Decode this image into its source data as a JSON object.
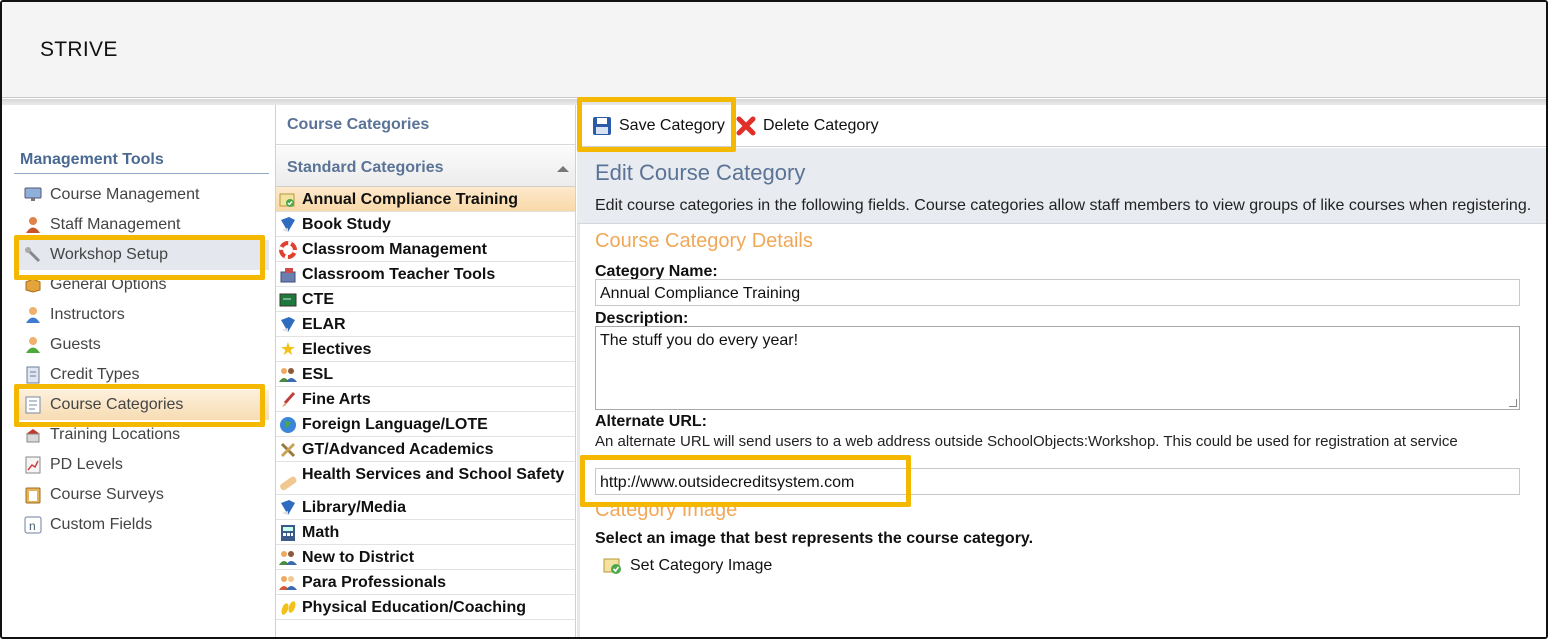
{
  "app": {
    "title": "STRIVE"
  },
  "sidebar": {
    "title": "Management Tools",
    "items": [
      {
        "label": "Course Management",
        "icon": "monitor-icon"
      },
      {
        "label": "Staff Management",
        "icon": "person-icon"
      },
      {
        "label": "Workshop Setup",
        "icon": "wrench-icon"
      },
      {
        "label": "General Options",
        "icon": "box-icon"
      },
      {
        "label": "Instructors",
        "icon": "instructor-icon"
      },
      {
        "label": "Guests",
        "icon": "guest-icon"
      },
      {
        "label": "Credit Types",
        "icon": "credit-icon"
      },
      {
        "label": "Course Categories",
        "icon": "list-icon"
      },
      {
        "label": "Training Locations",
        "icon": "building-icon"
      },
      {
        "label": "PD Levels",
        "icon": "chart-icon"
      },
      {
        "label": "Course Surveys",
        "icon": "clipboard-icon"
      },
      {
        "label": "Custom Fields",
        "icon": "field-icon"
      }
    ]
  },
  "categories": {
    "header": "Course Categories",
    "section": "Standard Categories",
    "items": [
      {
        "label": "Annual Compliance Training",
        "icon": "cert-icon"
      },
      {
        "label": "Book Study",
        "icon": "book-icon"
      },
      {
        "label": "Classroom Management",
        "icon": "lifebuoy-icon"
      },
      {
        "label": "Classroom Teacher Tools",
        "icon": "toolbox-icon"
      },
      {
        "label": "CTE",
        "icon": "board-icon"
      },
      {
        "label": "ELAR",
        "icon": "book-icon"
      },
      {
        "label": "Electives",
        "icon": "star-icon"
      },
      {
        "label": "ESL",
        "icon": "people-icon"
      },
      {
        "label": "Fine Arts",
        "icon": "brush-icon"
      },
      {
        "label": "Foreign Language/LOTE",
        "icon": "globe-icon"
      },
      {
        "label": "GT/Advanced Academics",
        "icon": "tools-icon"
      },
      {
        "label": "Health Services and School Safety",
        "icon": "bandage-icon"
      },
      {
        "label": "Library/Media",
        "icon": "book-icon"
      },
      {
        "label": "Math",
        "icon": "calculator-icon"
      },
      {
        "label": "New to District",
        "icon": "people-icon"
      },
      {
        "label": "Para Professionals",
        "icon": "people-icon"
      },
      {
        "label": "Physical Education/Coaching",
        "icon": "footprints-icon"
      }
    ]
  },
  "toolbar": {
    "save_label": "Save Category",
    "delete_label": "Delete Category"
  },
  "edit": {
    "title": "Edit Course Category",
    "description": "Edit course categories in the following fields. Course categories allow staff members to view groups of like courses when registering."
  },
  "form": {
    "section_title": "Course Category Details",
    "name_label": "Category Name:",
    "name_value": "Annual Compliance Training",
    "desc_label": "Description:",
    "desc_value": "The stuff you do every year!",
    "alt_url_label": "Alternate URL:",
    "alt_url_help": "An alternate URL will send users to a web address outside SchoolObjects:Workshop. This could be used for registration at service",
    "alt_url_value": "http://www.outsidecreditsystem.com",
    "image_section_title": "Category Image",
    "image_help": "Select an image that best represents the course category.",
    "set_image_label": "Set Category Image"
  },
  "colors": {
    "highlight": "#f5b800",
    "accent_blue": "#5a7396",
    "section_orange": "#f0a858"
  }
}
